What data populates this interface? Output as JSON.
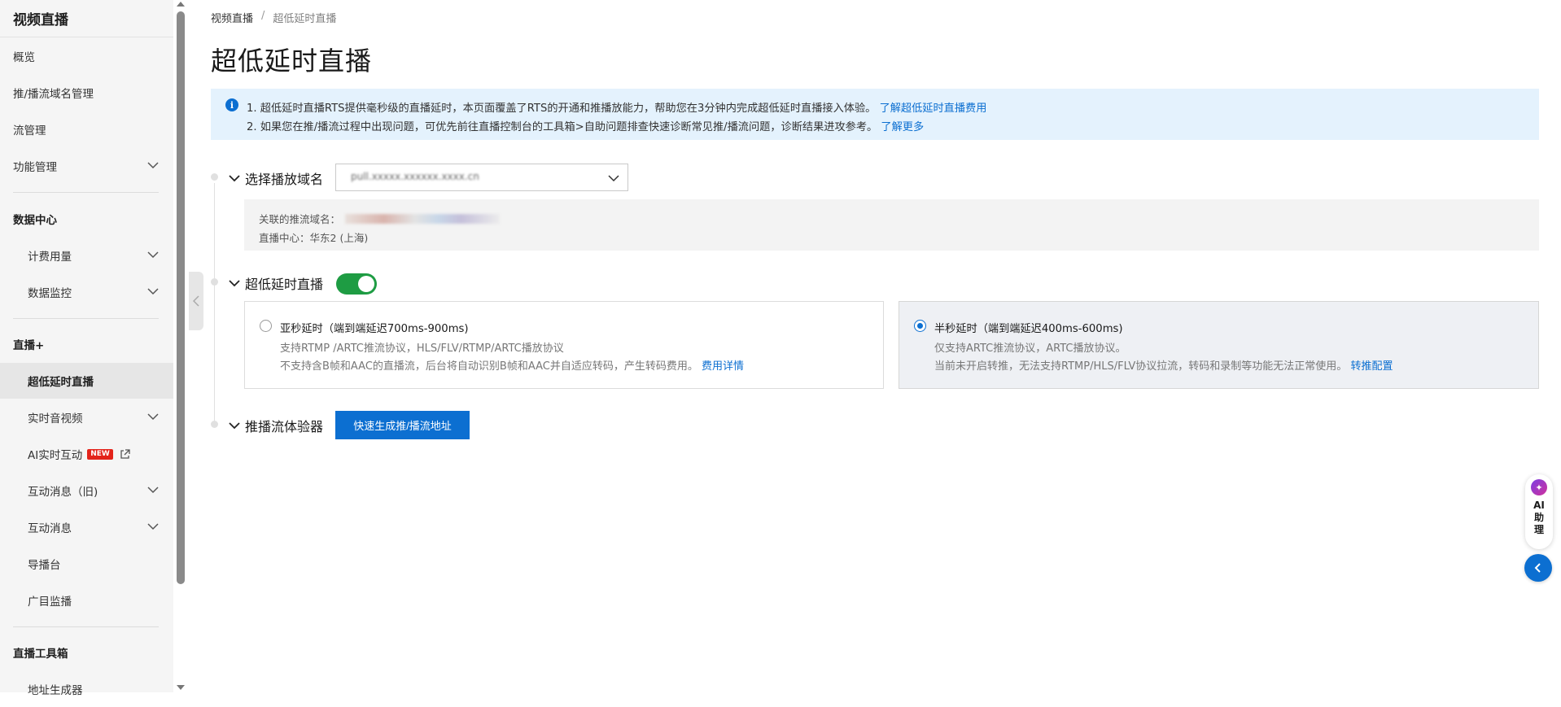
{
  "sidebar": {
    "title": "视频直播",
    "items": {
      "overview": "概览",
      "domain_mgmt": "推/播流域名管理",
      "stream_mgmt": "流管理",
      "feature_mgmt": "功能管理",
      "data_center": "数据中心",
      "billing_usage": "计费用量",
      "data_monitor": "数据监控",
      "live_plus": "直播+",
      "rts": "超低延时直播",
      "rt_av": "实时音视频",
      "ai_interact": "AI实时互动",
      "ai_interact_badge": "NEW",
      "interact_msg_old": "互动消息（旧)",
      "interact_msg": "互动消息",
      "director": "导播台",
      "ad_monitor": "广目监播",
      "toolbox": "直播工具箱",
      "addr_gen": "地址生成器"
    }
  },
  "breadcrumb": {
    "root": "视频直播",
    "sep": "/",
    "current": "超低延时直播"
  },
  "page": {
    "title": "超低延时直播"
  },
  "notice": {
    "line1_text": "1. 超低延时直播RTS提供毫秒级的直播延时，本页面覆盖了RTS的开通和推播放能力，帮助您在3分钟内完成超低延时直播接入体验。",
    "line1_link": "了解超低延时直播费用",
    "line2_text": "2. 如果您在推/播流过程中出现问题，可优先前往直播控制台的工具箱>自助问题排查快速诊断常见推/播流问题，诊断结果进攻参考。",
    "line2_link": "了解更多"
  },
  "section_domain": {
    "label": "选择播放域名",
    "selected_value": "pull.xxxxx.xxxxxx.xxxx.cn",
    "push_domain_label": "关联的推流域名：",
    "center_label": "直播中心：",
    "center_value": "华东2 (上海)"
  },
  "section_rts": {
    "label": "超低延时直播",
    "toggle_on": true,
    "option_subsecond": {
      "title": "亚秒延时（端到端延迟700ms-900ms)",
      "line1": "支持RTMP /ARTC推流协议，HLS/FLV/RTMP/ARTC播放协议",
      "line2": "不支持含B帧和AAC的直播流，后台将自动识别B帧和AAC并自适应转码，产生转码费用。",
      "link": "费用详情",
      "selected": false
    },
    "option_halfsecond": {
      "title": "半秒延时（端到端延迟400ms-600ms)",
      "line1": "仅支持ARTC推流协议，ARTC播放协议。",
      "line2": "当前未开启转推，无法支持RTMP/HLS/FLV协议拉流，转码和录制等功能无法正常使用。",
      "link": "转推配置",
      "selected": true
    }
  },
  "section_tester": {
    "label": "推播流体验器",
    "button": "快速生成推/播流地址"
  },
  "ai_assistant": {
    "label": "AI\n助\n理"
  },
  "colors": {
    "primary": "#0c6fd1",
    "toggle_on": "#1e9c43",
    "notice_bg": "#e4f2fd",
    "new_badge": "#e3231a"
  },
  "icons": [
    "chevron-down-icon",
    "info-icon",
    "external-link-icon",
    "chevron-left-icon",
    "ai-assistant-icon"
  ]
}
